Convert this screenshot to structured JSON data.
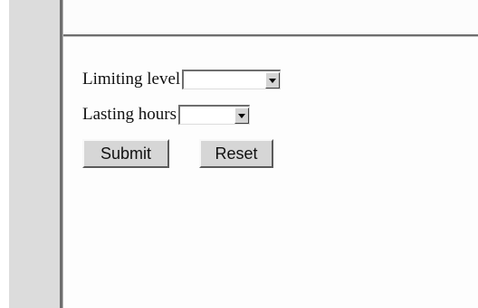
{
  "form": {
    "limiting_level_label": "Limiting level",
    "limiting_level_value": "",
    "lasting_hours_label": "Lasting hours",
    "lasting_hours_value": "",
    "submit_label": "Submit",
    "reset_label": "Reset"
  },
  "icons": {
    "dropdown_arrow": "chevron-down-icon"
  },
  "colors": {
    "sidebar": "#dcdcdc",
    "content_background": "#fdfdfd",
    "divider": "#6e6e6e",
    "button_face": "#d6d6d6"
  }
}
